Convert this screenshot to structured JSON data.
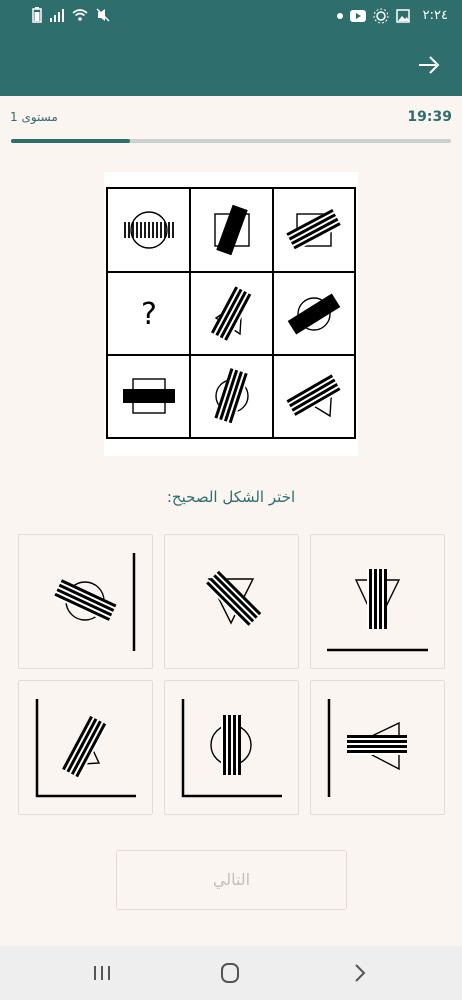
{
  "status_bar": {
    "time": "٢:٢٤",
    "icons": [
      "battery-icon",
      "signal-icon",
      "wifi-icon",
      "mute-icon",
      "dot-icon",
      "youtube-icon",
      "sun-icon",
      "image-icon"
    ]
  },
  "app_bar": {
    "back_icon": "arrow-right-icon"
  },
  "level": {
    "label": "مستوى 1",
    "timer": "19:39"
  },
  "progress": {
    "value": 0.27
  },
  "puzzle": {
    "missing_symbol": "?"
  },
  "prompt": "اختر الشكل الصحيح:",
  "options_count": 6,
  "next_button": "التالي",
  "nav_bar": {
    "icons": [
      "recents-icon",
      "home-icon",
      "back-chevron-icon"
    ]
  }
}
